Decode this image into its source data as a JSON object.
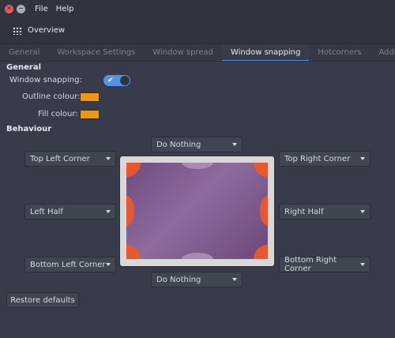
{
  "menu": {
    "file": "File",
    "help": "Help"
  },
  "toolbar": {
    "overview": "Overview"
  },
  "tabs": [
    {
      "label": "General",
      "active": false
    },
    {
      "label": "Workspace Settings",
      "active": false
    },
    {
      "label": "Window spread",
      "active": false
    },
    {
      "label": "Window snapping",
      "active": true
    },
    {
      "label": "Hotcorners",
      "active": false
    },
    {
      "label": "Additional",
      "active": false
    }
  ],
  "general": {
    "title": "General",
    "snapping_label": "Window snapping:",
    "snapping_enabled": true,
    "outline_label": "Outline colour:",
    "outline_color": "#f0960f",
    "fill_label": "Fill colour:",
    "fill_color": "#f0960f"
  },
  "behaviour": {
    "title": "Behaviour",
    "top": "Do Nothing",
    "top_left": "Top Left Corner",
    "top_right": "Top Right Corner",
    "left": "Left Half",
    "right": "Right Half",
    "bottom_left": "Bottom Left Corner",
    "bottom_right": "Bottom Right Corner",
    "bottom": "Do Nothing"
  },
  "restore_label": "Restore defaults",
  "colors": {
    "accent": "#5294e2",
    "hotspot": "#e8582a",
    "background": "#383c4a"
  }
}
